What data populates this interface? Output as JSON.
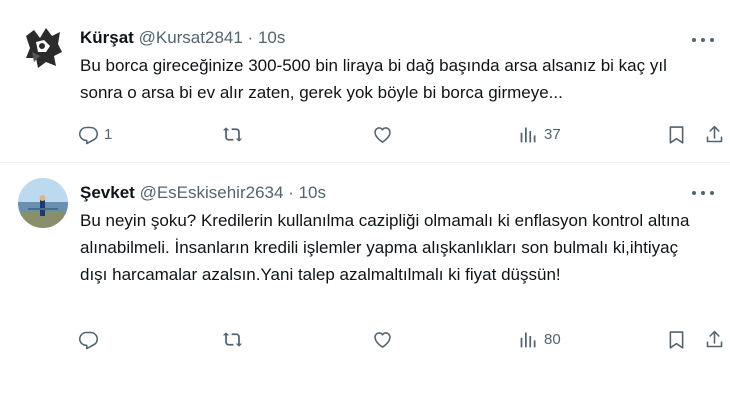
{
  "tweets": [
    {
      "name": "Kürşat",
      "handle": "@Kursat2841",
      "separator": "·",
      "time": "10s",
      "text": "Bu borca gireceğinize 300-500 bin liraya bi dağ başında arsa alsanız bi kaç yıl sonra o arsa bi ev alır zaten, gerek yok böyle bi borca girmeye...",
      "reply_count": "1",
      "retweet_count": "",
      "like_count": "",
      "view_count": "37"
    },
    {
      "name": "Şevket",
      "handle": "@EsEskisehir2634",
      "separator": "·",
      "time": "10s",
      "text": "Bu neyin şoku? Kredilerin kullanılma cazipliği olmamalı ki enflasyon kontrol altına alınabilmeli. İnsanların kredili işlemler yapma alışkanlıkları son bulmalı ki,ihtiyaç dışı harcamalar azalsın.Yani talep azalmaltılmalı ki fiyat düşsün!",
      "reply_count": "",
      "retweet_count": "",
      "like_count": "",
      "view_count": "80"
    }
  ],
  "icons": {
    "reply": "reply-icon",
    "retweet": "retweet-icon",
    "like": "like-icon",
    "views": "views-icon",
    "bookmark": "bookmark-icon",
    "share": "share-icon",
    "more": "more-icon"
  },
  "colors": {
    "text": "#0f1419",
    "secondary": "#536471",
    "divider": "#eff3f4"
  }
}
